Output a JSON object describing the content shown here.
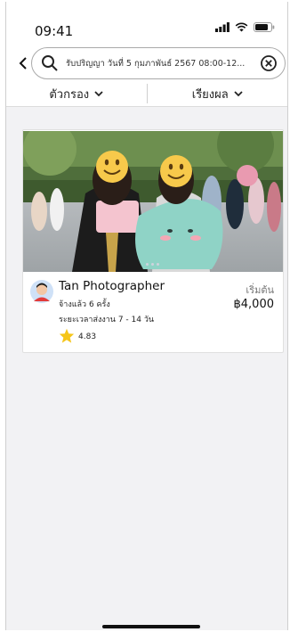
{
  "status": {
    "time": "09:41"
  },
  "search": {
    "query": "รับปริญญา วันที่ 5 กุมภาพันธ์ 2567 08:00-12..."
  },
  "filters": {
    "filter_label": "ตัวกรอง",
    "sort_label": "เรียงผล"
  },
  "listing": {
    "name": "Tan Photographer",
    "hires": "จ้างแล้ว 6 ครั้ง",
    "delivery": "ระยะเวลาส่งงาน 7 - 14 วัน",
    "rating": "4.83",
    "start_label": "เริ่มต้น",
    "price": "฿4,000"
  },
  "colors": {
    "accent": "#f5c518",
    "background": "#f2f2f4"
  }
}
